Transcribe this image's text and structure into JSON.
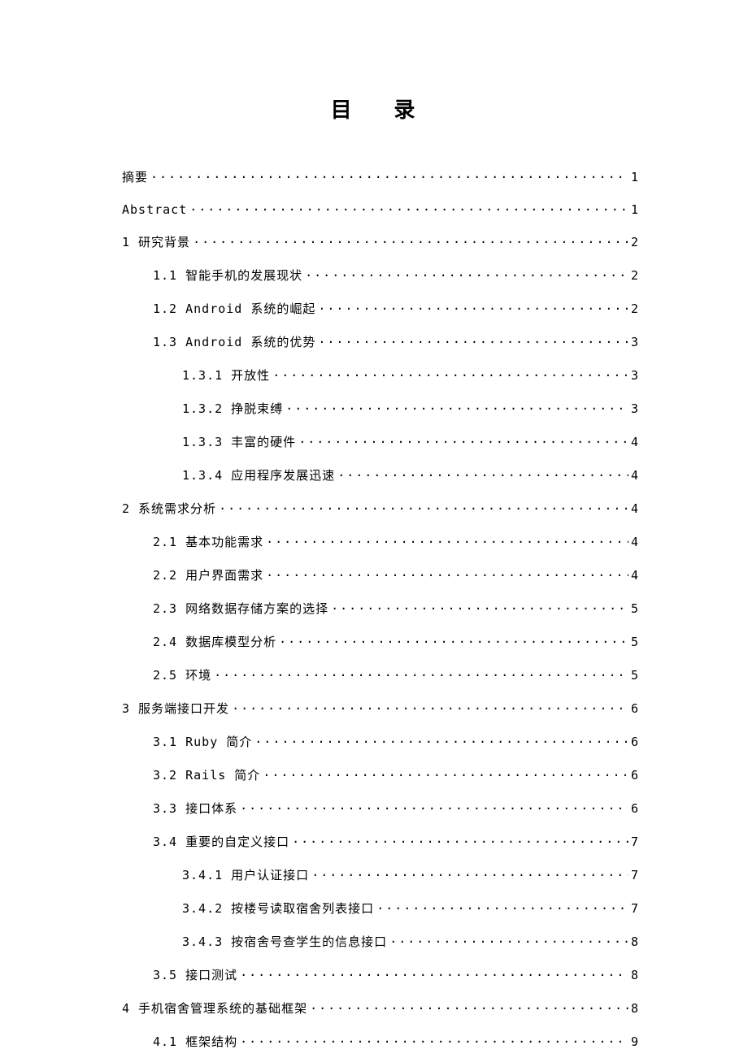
{
  "title": "目 录",
  "entries": [
    {
      "label": "摘要",
      "page": "1",
      "level": 0
    },
    {
      "label": "Abstract",
      "page": "1",
      "level": 0
    },
    {
      "label": "1 研究背景",
      "page": "2",
      "level": 0
    },
    {
      "label": "1.1 智能手机的发展现状",
      "page": "2",
      "level": 1
    },
    {
      "label": "1.2 Android 系统的崛起",
      "page": "2",
      "level": 1
    },
    {
      "label": "1.3 Android 系统的优势",
      "page": "3",
      "level": 1
    },
    {
      "label": "1.3.1 开放性",
      "page": "3",
      "level": 2
    },
    {
      "label": "1.3.2 挣脱束缚",
      "page": "3",
      "level": 2
    },
    {
      "label": "1.3.3 丰富的硬件",
      "page": "4",
      "level": 2
    },
    {
      "label": "1.3.4 应用程序发展迅速",
      "page": "4",
      "level": 2
    },
    {
      "label": "2 系统需求分析",
      "page": "4",
      "level": 0
    },
    {
      "label": "2.1 基本功能需求",
      "page": "4",
      "level": 1
    },
    {
      "label": "2.2 用户界面需求",
      "page": "4",
      "level": 1
    },
    {
      "label": "2.3 网络数据存储方案的选择",
      "page": "5",
      "level": 1
    },
    {
      "label": "2.4 数据库模型分析",
      "page": "5",
      "level": 1
    },
    {
      "label": "2.5 环境",
      "page": "5",
      "level": 1
    },
    {
      "label": "3 服务端接口开发",
      "page": "6",
      "level": 0
    },
    {
      "label": "3.1 Ruby 简介",
      "page": "6",
      "level": 1
    },
    {
      "label": "3.2 Rails 简介",
      "page": "6",
      "level": 1
    },
    {
      "label": "3.3 接口体系",
      "page": "6",
      "level": 1
    },
    {
      "label": "3.4 重要的自定义接口",
      "page": "7",
      "level": 1
    },
    {
      "label": "3.4.1 用户认证接口",
      "page": "7",
      "level": 2
    },
    {
      "label": "3.4.2 按楼号读取宿舍列表接口",
      "page": "7",
      "level": 2
    },
    {
      "label": "3.4.3 按宿舍号查学生的信息接口",
      "page": "8",
      "level": 2
    },
    {
      "label": "3.5 接口测试",
      "page": "8",
      "level": 1
    },
    {
      "label": "4 手机宿舍管理系统的基础框架",
      "page": "8",
      "level": 0
    },
    {
      "label": "4.1 框架结构",
      "page": "9",
      "level": 1
    }
  ]
}
